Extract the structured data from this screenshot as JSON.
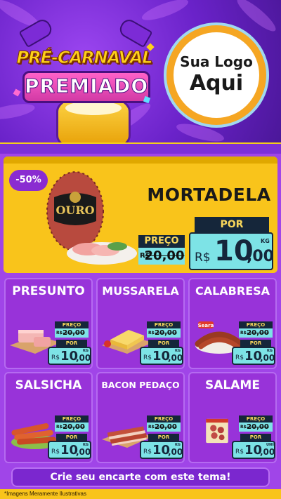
{
  "header": {
    "title_line1": "PRÉ-CARNAVAL",
    "title_line2": "PREMIADO",
    "logo_line1": "Sua Logo",
    "logo_line2": "Aqui"
  },
  "featured": {
    "discount": "-50%",
    "name": "MORTADELA",
    "brand": "OURO",
    "price_label": "PREÇO",
    "old_currency": "R$",
    "old_price": "20,00",
    "por_label": "POR",
    "currency": "R$",
    "price_int": "10",
    "price_cents": ",00",
    "unit": "KG"
  },
  "products": [
    {
      "name": "PRESUNTO",
      "price_label": "PREÇO",
      "old_currency": "R$",
      "old_price": "20,00",
      "por_label": "POR",
      "currency": "R$",
      "price_int": "10",
      "price_cents": ",00",
      "unit": "KG",
      "image": "ham-slices-icon"
    },
    {
      "name": "MUSSARELA",
      "price_label": "PREÇO",
      "old_currency": "R$",
      "old_price": "20,00",
      "por_label": "POR",
      "currency": "R$",
      "price_int": "10",
      "price_cents": ",00",
      "unit": "KG",
      "image": "cheese-icon"
    },
    {
      "name": "CALABRESA",
      "price_label": "PREÇO",
      "old_currency": "R$",
      "old_price": "20,00",
      "por_label": "POR",
      "currency": "R$",
      "price_int": "10",
      "price_cents": ",00",
      "unit": "KG",
      "image": "sausage-ring-icon",
      "brand": "Seara"
    },
    {
      "name": "SALSICHA",
      "price_label": "PREÇO",
      "old_currency": "R$",
      "old_price": "20,00",
      "por_label": "POR",
      "currency": "R$",
      "price_int": "10",
      "price_cents": ",00",
      "unit": "KG",
      "image": "hotdog-sausages-icon"
    },
    {
      "name": "BACON PEDAÇO",
      "price_label": "PREÇO",
      "old_currency": "R$",
      "old_price": "20,00",
      "por_label": "POR",
      "currency": "R$",
      "price_int": "10",
      "price_cents": ",00",
      "unit": "KG",
      "image": "bacon-icon"
    },
    {
      "name": "SALAME",
      "price_label": "PREÇO",
      "old_currency": "R$",
      "old_price": "20,00",
      "por_label": "POR",
      "currency": "R$",
      "price_int": "10",
      "price_cents": ",00",
      "unit": "UNID",
      "image": "salami-pack-icon"
    }
  ],
  "footer": {
    "cta": "Crie seu encarte com este tema!",
    "disclaimer": "*Imagens Meramente Ilustrativas"
  },
  "colors": {
    "purple": "#9833d9",
    "yellow": "#f9c41b",
    "navy": "#15263a",
    "cyan": "#7de3e6",
    "gold_text": "#f9d75b"
  }
}
